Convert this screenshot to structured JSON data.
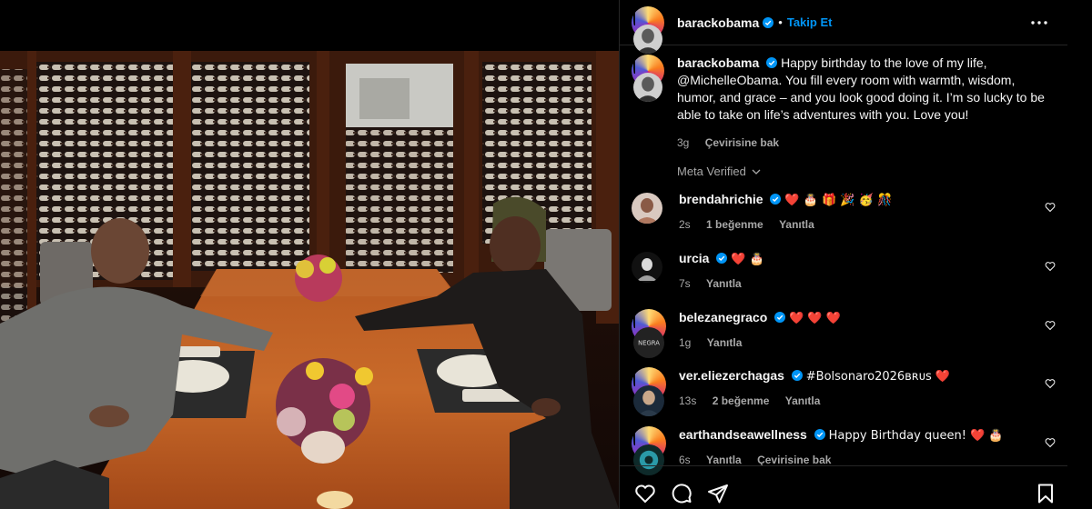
{
  "post": {
    "username": "barackobama",
    "follow_label": "Takip Et",
    "dot": "•",
    "caption": "Happy birthday to the love of my life, @MichelleObama. You fill every room with warmth, wisdom, humor, and grace – and you look good doing it. I’m so lucky to be able to take on life’s adventures with you. Love you!",
    "time": "3g",
    "translate": "Çevirisine bak",
    "meta_verified": "Meta Verified"
  },
  "comments": [
    {
      "user": "brendahrichie",
      "text": "❤️ 🎂 🎁 🎉 🥳 🎊",
      "time": "2s",
      "likes": "1 beğenme",
      "reply": "Yanıtla",
      "translate": ""
    },
    {
      "user": "urcia",
      "text": "❤️ 🎂",
      "time": "7s",
      "likes": "",
      "reply": "Yanıtla",
      "translate": ""
    },
    {
      "user": "belezanegraco",
      "text": "❤️ ❤️ ❤️",
      "time": "1g",
      "likes": "",
      "reply": "Yanıtla",
      "translate": ""
    },
    {
      "user": "ver.eliezerchagas",
      "text": "#Bolsonaro2026ʙʀᴜs ❤️",
      "time": "13s",
      "likes": "2 beğenme",
      "reply": "Yanıtla",
      "translate": ""
    },
    {
      "user": "earthandseawellness",
      "text": "Happy Birthday queen! ❤️ 🎂",
      "time": "6s",
      "likes": "",
      "reply": "Yanıtla",
      "translate": "Çevirisine bak"
    }
  ],
  "icons": {
    "verified": "verified-badge-icon",
    "more": "more-options-icon",
    "heart": "heart-icon",
    "comment": "comment-icon",
    "share": "share-icon",
    "save": "bookmark-icon",
    "chevron": "chevron-down-icon"
  },
  "colors": {
    "accent": "#0095f6",
    "verified": "#0095f6",
    "heart": "#ff3040",
    "muted": "#a8a8a8"
  }
}
